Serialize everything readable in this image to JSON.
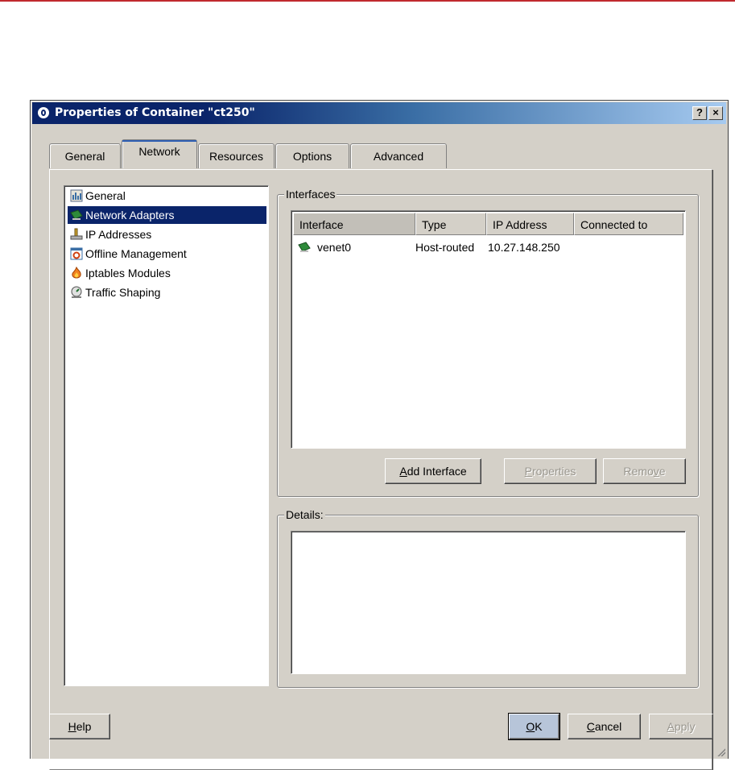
{
  "window": {
    "title": "Properties of Container \"ct250\"",
    "help_btn": "?",
    "close_btn": "×"
  },
  "tabs": [
    {
      "label": "General",
      "active": false
    },
    {
      "label": "Network",
      "active": true
    },
    {
      "label": "Resources",
      "active": false
    },
    {
      "label": "Options",
      "active": false
    },
    {
      "label": "Advanced",
      "active": false
    }
  ],
  "tree": {
    "selected": "Network Adapters",
    "items": [
      {
        "label": "General",
        "icon": "general-icon"
      },
      {
        "label": "Network Adapters",
        "icon": "network-adapter-icon"
      },
      {
        "label": "IP Addresses",
        "icon": "ip-address-icon"
      },
      {
        "label": "Offline Management",
        "icon": "offline-management-icon"
      },
      {
        "label": "Iptables Modules",
        "icon": "iptables-fire-icon"
      },
      {
        "label": "Traffic Shaping",
        "icon": "traffic-shaping-icon"
      }
    ]
  },
  "interfaces": {
    "group_label": "Interfaces",
    "columns": [
      "Interface",
      "Type",
      "IP Address",
      "Connected to"
    ],
    "rows": [
      {
        "interface": "venet0",
        "type": "Host-routed",
        "ip": "10.27.148.250",
        "connected_to": ""
      }
    ],
    "buttons": {
      "add": {
        "prefix": "",
        "mnemonic": "A",
        "rest": "dd Interface"
      },
      "properties": {
        "prefix": "",
        "mnemonic": "P",
        "rest": "roperties"
      },
      "remove": {
        "prefix": "Remo",
        "mnemonic": "v",
        "rest": "e"
      }
    }
  },
  "details": {
    "group_label": "Details:"
  },
  "footer": {
    "help": {
      "mnemonic": "H",
      "rest": "elp"
    },
    "ok": {
      "mnemonic": "O",
      "rest": "K"
    },
    "cancel": {
      "mnemonic": "C",
      "rest": "ancel"
    },
    "apply": {
      "mnemonic": "A",
      "rest": "pply"
    }
  },
  "colors": {
    "title_start": "#0a246a",
    "title_end": "#a6caf0",
    "selection": "#0a246a",
    "face": "#d4d0c8",
    "accent_top": "#c0292e"
  }
}
